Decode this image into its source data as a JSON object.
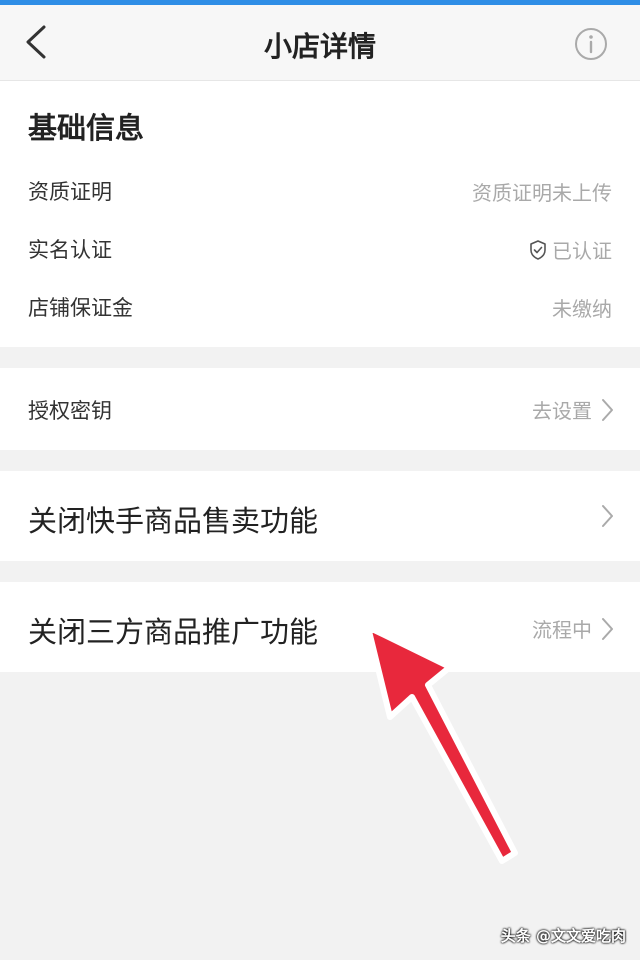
{
  "header": {
    "title": "小店详情"
  },
  "basic_info": {
    "title": "基础信息",
    "rows": [
      {
        "label": "资质证明",
        "value": "资质证明未上传"
      },
      {
        "label": "实名认证",
        "value": "已认证"
      },
      {
        "label": "店铺保证金",
        "value": "未缴纳"
      }
    ]
  },
  "auth_key": {
    "label": "授权密钥",
    "action": "去设置"
  },
  "close_kuaishou": {
    "label": "关闭快手商品售卖功能"
  },
  "close_third_party": {
    "label": "关闭三方商品推广功能",
    "status": "流程中"
  },
  "watermark": "头条 @文文爱吃肉",
  "colors": {
    "accent": "#2f8ee6",
    "arrow": "#e8283c"
  }
}
